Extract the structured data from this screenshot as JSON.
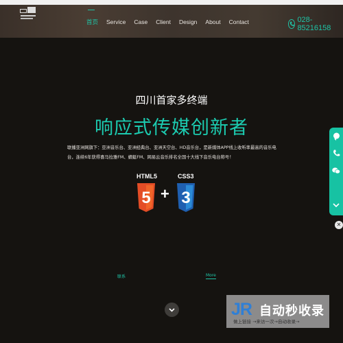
{
  "nav": {
    "items": [
      "首页",
      "Service",
      "Case",
      "Client",
      "Design",
      "About",
      "Contact"
    ],
    "active_index": 0
  },
  "contact": {
    "phone": "028-85216158"
  },
  "hero": {
    "subtitle": "四川首家多终端",
    "title": "响应式传媒创新者",
    "description": "联播亚洲网旗下：亚洲音乐台、亚洲经典台、亚洲天空台、HD音乐台，是新媒体APP线上收听率最高的音乐电台，连续6年获得喜马拉雅FM、蜻蜓FM、网易云音乐排名全国十大线下音乐电台称号！",
    "badges": {
      "left": "HTML5",
      "left_num": "5",
      "plus": "+",
      "right": "CSS3",
      "right_num": "3"
    }
  },
  "links": {
    "left": "联系",
    "right": "More"
  },
  "watermark": {
    "logo": "JR",
    "brand": "自动秒收录",
    "tagline": "做上链接 →来访一次→自动收录→"
  },
  "colors": {
    "accent": "#1fc3a6",
    "background": "#151310",
    "html5": "#e44d26",
    "css3": "#1f6fc0"
  },
  "icons": [
    "phone-icon",
    "chat-icon",
    "call-icon",
    "wechat-icon",
    "chevron-down-icon",
    "close-icon"
  ]
}
